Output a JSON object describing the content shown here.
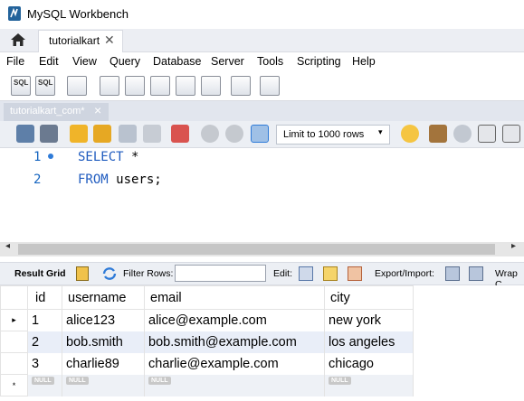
{
  "window": {
    "title": "MySQL Workbench"
  },
  "connection_tab": {
    "label": "tutorialkart",
    "close": "✕"
  },
  "menu": [
    "File",
    "Edit",
    "View",
    "Query",
    "Database",
    "Server",
    "Tools",
    "Scripting",
    "Help"
  ],
  "main_toolbar": {
    "icons": [
      "new-sql-tab-icon",
      "open-sql-file-icon",
      "inspector-icon",
      "create-schema-icon",
      "create-table-icon",
      "create-view-icon",
      "create-procedure-icon",
      "create-function-icon",
      "search-table-icon",
      "reconnect-icon"
    ],
    "badge_sql": "SQL"
  },
  "editor_tab": {
    "label": "tutorialkart_com*",
    "close": "×"
  },
  "sql_toolbar": {
    "limit_label": "Limit to 1000 rows",
    "limit_arrow": "▾"
  },
  "editor": {
    "lines": [
      {
        "number": "1",
        "keyword": "SELECT",
        "rest": " *"
      },
      {
        "number": "2",
        "keyword": "FROM",
        "rest": " users;"
      }
    ]
  },
  "result_bar": {
    "result_grid": "Result Grid",
    "filter_rows": "Filter Rows:",
    "filter_value": "",
    "edit": "Edit:",
    "export_import": "Export/Import:",
    "wrap": "Wrap C"
  },
  "grid": {
    "columns": [
      "id",
      "username",
      "email",
      "city"
    ],
    "rows": [
      {
        "marker": "▸",
        "id": "1",
        "username": "alice123",
        "email": "alice@example.com",
        "city": "new york"
      },
      {
        "marker": "",
        "id": "2",
        "username": "bob.smith",
        "email": "bob.smith@example.com",
        "city": "los angeles"
      },
      {
        "marker": "",
        "id": "3",
        "username": "charlie89",
        "email": "charlie@example.com",
        "city": "chicago"
      }
    ],
    "new_row": {
      "marker": "*",
      "null": "NULL"
    }
  },
  "colors": {
    "keyword": "#1f5bbf",
    "line_number": "#1565c0",
    "selected_row": "#e9eef8",
    "accent": "#2f7bd8"
  }
}
